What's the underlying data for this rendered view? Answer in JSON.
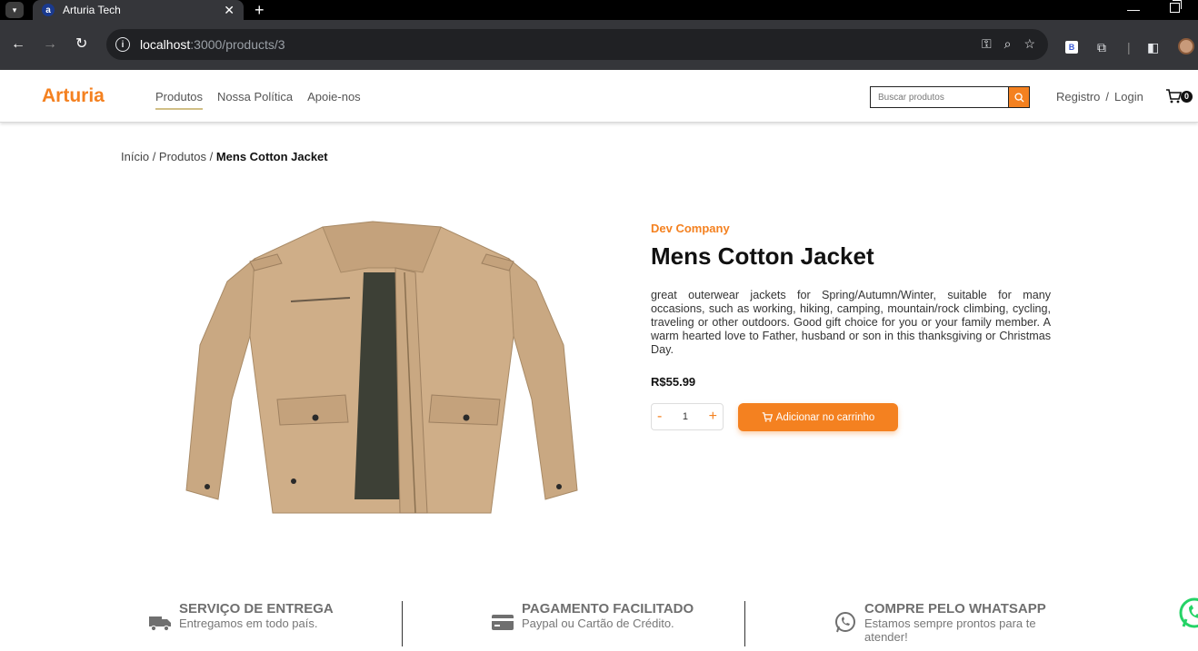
{
  "browser": {
    "tab_title": "Arturia Tech",
    "favicon_letter": "a",
    "url_host": "localhost",
    "url_path": ":3000/products/3",
    "ext_label": "B"
  },
  "header": {
    "logo": "Arturia",
    "nav": [
      "Produtos",
      "Nossa Política",
      "Apoie-nos"
    ],
    "search_placeholder": "Buscar produtos",
    "register": "Registro",
    "separator": "/",
    "login": "Login",
    "cart_count": "0"
  },
  "breadcrumb": {
    "home": "Início",
    "sep1": " / ",
    "products": "Produtos",
    "sep2": " / ",
    "current": "Mens Cotton Jacket"
  },
  "product": {
    "brand": "Dev Company",
    "title": "Mens Cotton Jacket",
    "description": "great outerwear jackets for Spring/Autumn/Winter, suitable for many occasions, such as working, hiking, camping, mountain/rock climbing, cycling, traveling or other outdoors. Good gift choice for you or your family member. A warm hearted love to Father, husband or son in this thanksgiving or Christmas Day.",
    "price": "R$55.99",
    "qty_minus": "-",
    "quantity": "1",
    "qty_plus": "+",
    "add_to_cart": "Adicionar no carrinho"
  },
  "features": [
    {
      "title": "SERVIÇO DE ENTREGA",
      "subtitle": "Entregamos em todo país.",
      "icon": "truck-icon"
    },
    {
      "title": "PAGAMENTO FACILITADO",
      "subtitle": "Paypal ou Cartão de Crédito.",
      "icon": "credit-card-icon"
    },
    {
      "title": "COMPRE PELO WHATSAPP",
      "subtitle": "Estamos sempre prontos para te atender!",
      "icon": "whatsapp-icon"
    }
  ],
  "colors": {
    "accent": "#f48120",
    "jacket": "#c9a882",
    "whatsapp": "#25d366"
  }
}
